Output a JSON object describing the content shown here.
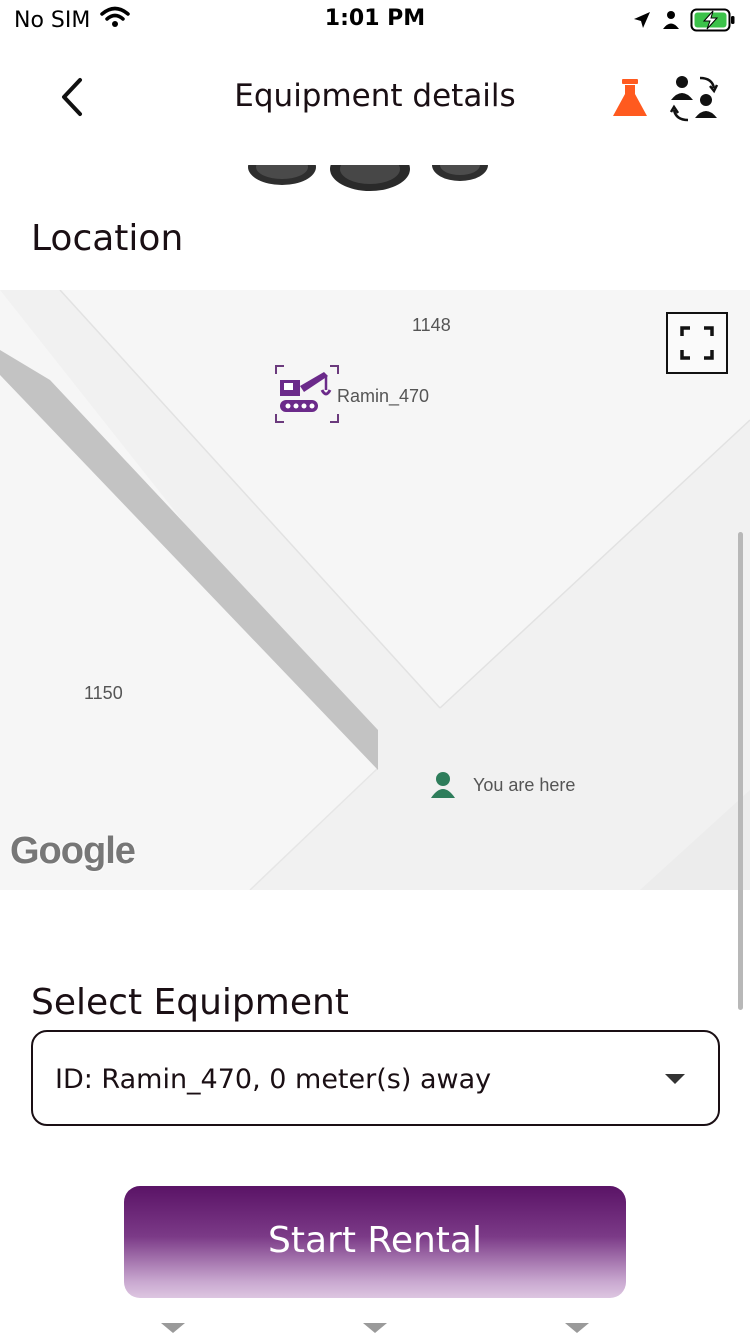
{
  "status_bar": {
    "carrier": "No SIM",
    "time": "1:01 PM"
  },
  "nav": {
    "title": "Equipment details",
    "flask_color": "#ff5a1f"
  },
  "location": {
    "title": "Location"
  },
  "map": {
    "labels": {
      "top": "1148",
      "left": "1150"
    },
    "equipment_marker_label": "Ramin_470",
    "user_marker_label": "You are here",
    "attribution": "Google"
  },
  "select_equipment": {
    "title": "Select Equipment",
    "selected_value": "ID: Ramin_470, 0 meter(s) away"
  },
  "start_button": {
    "label": "Start Rental"
  },
  "colors": {
    "brand_purple": "#5a1366",
    "user_marker_green": "#2e7d5b"
  }
}
